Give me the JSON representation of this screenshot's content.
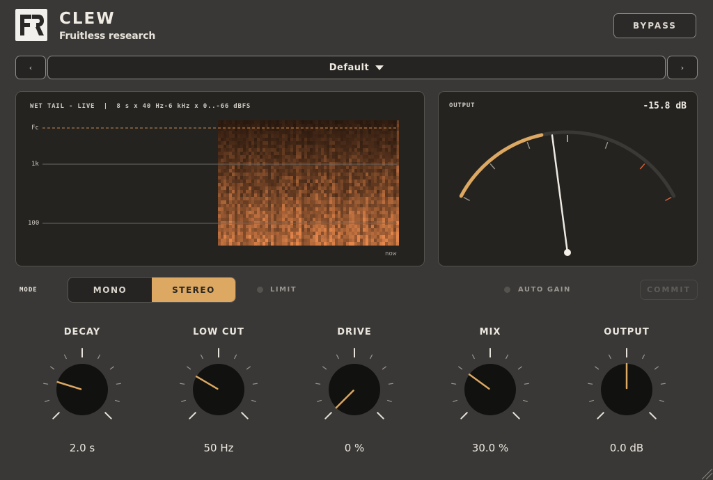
{
  "header": {
    "logo_letters": "FR",
    "title": "CLEW",
    "subtitle": "Fruitless research",
    "bypass_label": "BYPASS"
  },
  "preset": {
    "prev_label": "‹",
    "next_label": "›",
    "name": "Default"
  },
  "spectrogram": {
    "header": "WET TAIL - LIVE  |  8 s x 40 Hz-6 kHz x 0..-66 dBFS",
    "fc_label": "Fc",
    "grid_labels": [
      "1k",
      "100"
    ],
    "time_label": "now",
    "accent_color": "#d9915a"
  },
  "output_meter": {
    "label": "OUTPUT",
    "value_text": "-15.8 dB",
    "level_fraction": 0.4,
    "needle_fraction": 0.44,
    "arc_color": "#dca862",
    "hot_color": "#e0623a"
  },
  "mode": {
    "label": "MODE",
    "options": [
      "MONO",
      "STEREO"
    ],
    "selected": "STEREO",
    "limit_label": "LIMIT",
    "auto_gain_label": "AUTO GAIN",
    "commit_label": "COMMIT"
  },
  "knobs": [
    {
      "id": "decay",
      "title": "DECAY",
      "value": "2.0 s",
      "fraction": 0.23
    },
    {
      "id": "low-cut",
      "title": "LOW CUT",
      "value": "50 Hz",
      "fraction": 0.28
    },
    {
      "id": "drive",
      "title": "DRIVE",
      "value": "0 %",
      "fraction": 0.0
    },
    {
      "id": "mix",
      "title": "MIX",
      "value": "30.0 %",
      "fraction": 0.3
    },
    {
      "id": "output",
      "title": "OUTPUT",
      "value": "0.0 dB",
      "fraction": 0.5
    }
  ],
  "colors": {
    "background": "#393836",
    "panel": "#24231f",
    "accent": "#dca862"
  }
}
